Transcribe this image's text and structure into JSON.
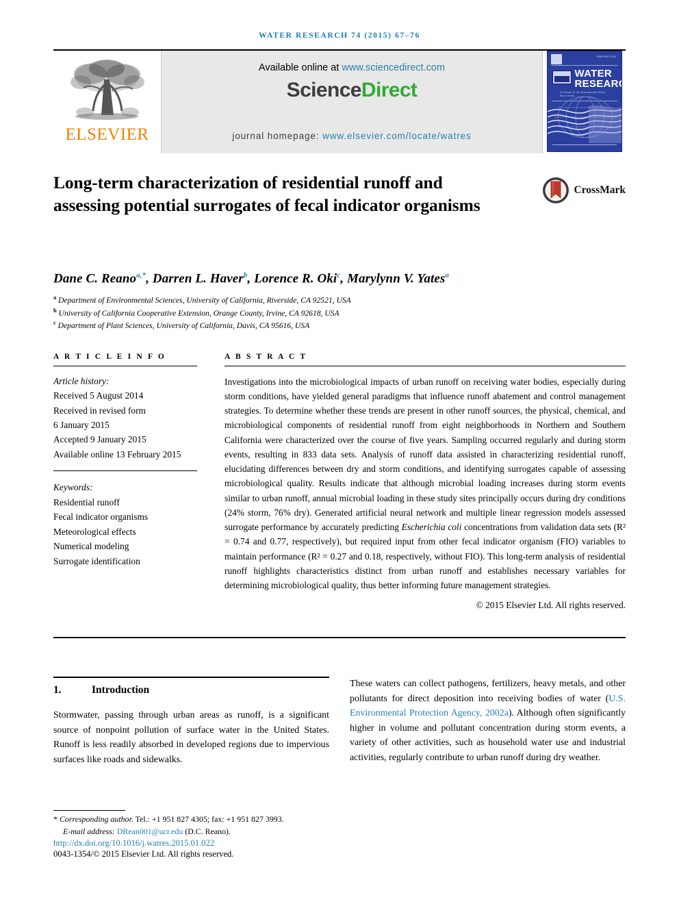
{
  "running_head": "WATER RESEARCH 74 (2015) 67–76",
  "masthead": {
    "publisher_name": "ELSEVIER",
    "available_prefix": "Available online at ",
    "available_url": "www.sciencedirect.com",
    "sciencedirect_part1": "Science",
    "sciencedirect_part2": "Direct",
    "homepage_prefix": "journal homepage: ",
    "homepage_url": "www.elsevier.com/locate/watres",
    "cover": {
      "title_line1": "WATER",
      "title_line2": "RESEARCH",
      "subtitle": "A Journal of the International Water Association",
      "issn_text": "ISSN 0043-1354",
      "iwa_label": "IWA"
    }
  },
  "article": {
    "title": "Long-term characterization of residential runoff and assessing potential surrogates of fecal indicator organisms",
    "crossmark_label": "CrossMark",
    "authors": [
      {
        "name": "Dane C. Reano",
        "marks": "a,*"
      },
      {
        "name": "Darren L. Haver",
        "marks": "b"
      },
      {
        "name": "Lorence R. Oki",
        "marks": "c"
      },
      {
        "name": "Marylynn V. Yates",
        "marks": "a"
      }
    ],
    "affiliations": [
      {
        "mark": "a",
        "text": "Department of Environmental Sciences, University of California, Riverside, CA 92521, USA"
      },
      {
        "mark": "b",
        "text": "University of California Cooperative Extension, Orange County, Irvine, CA 92618, USA"
      },
      {
        "mark": "c",
        "text": "Department of Plant Sciences, University of California, Davis, CA 95616, USA"
      }
    ]
  },
  "article_info": {
    "heading": "A R T I C L E  I N F O",
    "history_label": "Article history:",
    "history": [
      "Received 5 August 2014",
      "Received in revised form",
      "6 January 2015",
      "Accepted 9 January 2015",
      "Available online 13 February 2015"
    ],
    "keywords_label": "Keywords:",
    "keywords": [
      "Residential runoff",
      "Fecal indicator organisms",
      "Meteorological effects",
      "Numerical modeling",
      "Surrogate identification"
    ]
  },
  "abstract": {
    "heading": "A B S T R A C T",
    "part1": "Investigations into the microbiological impacts of urban runoff on receiving water bodies, especially during storm conditions, have yielded general paradigms that influence runoff abatement and control management strategies. To determine whether these trends are present in other runoff sources, the physical, chemical, and microbiological components of residential runoff from eight neighborhoods in Northern and Southern California were characterized over the course of five years. Sampling occurred regularly and during storm events, resulting in 833 data sets. Analysis of runoff data assisted in characterizing residential runoff, elucidating differences between dry and storm conditions, and identifying surrogates capable of assessing microbiological quality. Results indicate that although microbial loading increases during storm events similar to urban runoff, annual microbial loading in these study sites principally occurs during dry conditions (24% storm, 76% dry). Generated artificial neural network and multiple linear regression models assessed surrogate performance by accurately predicting ",
    "italic_species": "Escherichia coli",
    "part2": " concentrations from validation data sets (R² = 0.74 and 0.77, respectively), but required input from other fecal indicator organism (FIO) variables to maintain performance (R² = 0.27 and 0.18, respectively, without FIO). This long-term analysis of residential runoff highlights characteristics distinct from urban runoff and establishes necessary variables for determining microbiological quality, thus better informing future management strategies.",
    "copyright": "© 2015 Elsevier Ltd. All rights reserved."
  },
  "introduction": {
    "number": "1.",
    "title": "Introduction",
    "left_paragraph": "Stormwater, passing through urban areas as runoff, is a significant source of nonpoint pollution of surface water in the United States. Runoff is less readily absorbed in developed regions due to impervious surfaces like roads and sidewalks.",
    "right_part1": "These waters can collect pathogens, fertilizers, heavy metals, and other pollutants for direct deposition into receiving bodies of water (",
    "right_citation": "U.S. Environmental Protection Agency, 2002a",
    "right_part2": "). Although often significantly higher in volume and pollutant concentration during storm events, a variety of other activities, such as household water use and industrial activities, regularly contribute to urban runoff during dry weather."
  },
  "footer": {
    "corresponding_marker": "*",
    "corresponding_label": "Corresponding author.",
    "corresponding_contact": " Tel.: +1 951 827 4305; fax: +1 951 827 3993.",
    "email_label": "E-mail address: ",
    "email_address": "DRean001@ucr.edu",
    "email_suffix": " (D.C. Reano).",
    "doi": "http://dx.doi.org/10.1016/j.watres.2015.01.022",
    "issn_line": "0043-1354/© 2015 Elsevier Ltd. All rights reserved."
  },
  "colors": {
    "link_blue": "#2a7fae",
    "header_blue": "#1a7db5",
    "elsevier_orange": "#f08000",
    "sciencedirect_green": "#33aa33",
    "cover_blue": "#2b3f9e"
  }
}
